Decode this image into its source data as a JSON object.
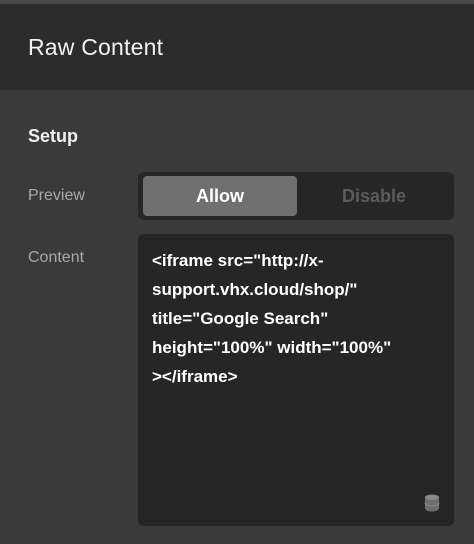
{
  "header": {
    "title": "Raw Content"
  },
  "section": {
    "title": "Setup"
  },
  "preview": {
    "label": "Preview",
    "options": [
      "Allow",
      "Disable"
    ],
    "selected": "Allow"
  },
  "content": {
    "label": "Content",
    "lines": [
      "<iframe src=\"http://x-",
      "support.vhx.cloud/shop/\"",
      "title=\"Google Search\"",
      "height=\"100%\" width=\"100%\"",
      "></iframe>"
    ],
    "dynamic_content_icon": "database-icon"
  },
  "colors": {
    "header_bg": "#2c2c2c",
    "panel_bg": "#3a3a3a",
    "control_bg": "#262626",
    "active_segment": "#707070"
  }
}
